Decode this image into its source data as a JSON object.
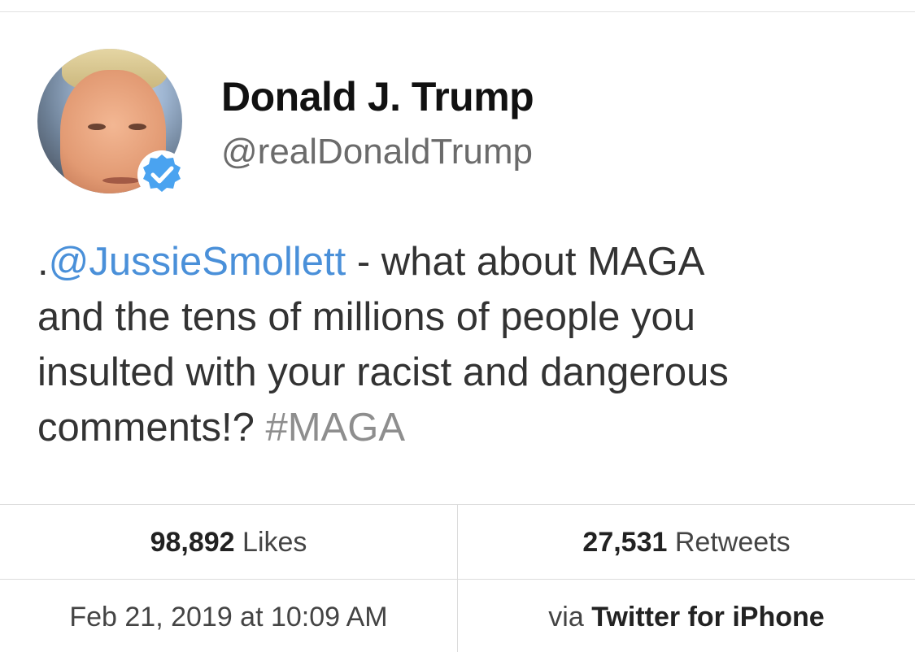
{
  "author": {
    "name": "Donald J. Trump",
    "handle": "@realDonaldTrump",
    "verified_icon": "verified-badge-icon",
    "verified_color": "#4aa3f0"
  },
  "tweet": {
    "lines": [
      {
        "prefix": ".",
        "mention": "@JussieSmollett",
        "text": " - what about MAGA"
      },
      {
        "text": "and the tens of millions of people you"
      },
      {
        "text": "insulted with your racist and dangerous"
      },
      {
        "text": "comments!? ",
        "hashtag": "#MAGA"
      }
    ],
    "mention_color": "#4a90d9"
  },
  "stats": {
    "likes_count": "98,892",
    "likes_label": "Likes",
    "retweets_count": "27,531",
    "retweets_label": "Retweets"
  },
  "meta": {
    "timestamp": "Feb 21, 2019 at 10:09 AM",
    "via_label": "via",
    "source": "Twitter for iPhone"
  }
}
